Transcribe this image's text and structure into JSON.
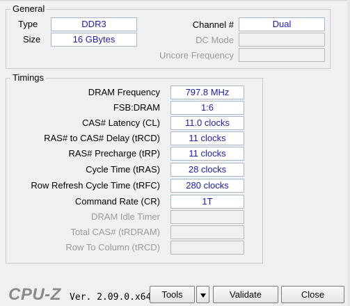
{
  "general": {
    "title": "General",
    "type_label": "Type",
    "type_value": "DDR3",
    "size_label": "Size",
    "size_value": "16 GBytes",
    "channel_label": "Channel #",
    "channel_value": "Dual",
    "dcmode_label": "DC Mode",
    "dcmode_value": "",
    "uncore_label": "Uncore Frequency",
    "uncore_value": ""
  },
  "timings": {
    "title": "Timings",
    "rows": [
      {
        "label": "DRAM Frequency",
        "value": "797.8 MHz"
      },
      {
        "label": "FSB:DRAM",
        "value": "1:6"
      },
      {
        "label": "CAS# Latency (CL)",
        "value": "11.0 clocks"
      },
      {
        "label": "RAS# to CAS# Delay (tRCD)",
        "value": "11 clocks"
      },
      {
        "label": "RAS# Precharge (tRP)",
        "value": "11 clocks"
      },
      {
        "label": "Cycle Time (tRAS)",
        "value": "28 clocks"
      },
      {
        "label": "Row Refresh Cycle Time (tRFC)",
        "value": "280 clocks"
      },
      {
        "label": "Command Rate (CR)",
        "value": "1T"
      },
      {
        "label": "DRAM Idle Timer",
        "value": ""
      },
      {
        "label": "Total CAS# (tRDRAM)",
        "value": ""
      },
      {
        "label": "Row To Column (tRCD)",
        "value": ""
      }
    ]
  },
  "footer": {
    "logo": "CPU-Z",
    "version": "Ver. 2.09.0.x64",
    "tools_label": "Tools",
    "validate_label": "Validate",
    "close_label": "Close"
  }
}
